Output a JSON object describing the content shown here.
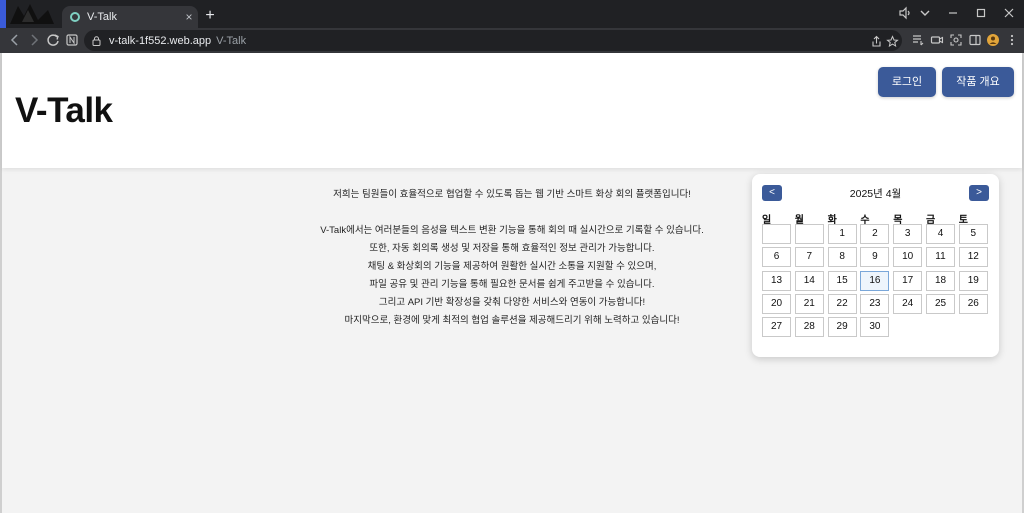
{
  "browser": {
    "tab_title": "V-Talk",
    "tab_close": "×",
    "new_tab": "+",
    "url": "v-talk-1f552.web.app",
    "url_page_title": "V-Talk",
    "window_controls": [
      "minimize-icon",
      "maximize-icon",
      "close-icon"
    ]
  },
  "header": {
    "logo": "V-Talk",
    "login_button": "로그인",
    "about_button": "작품 개요"
  },
  "intro": {
    "lead": "저희는 팀원들이 효율적으로 협업할 수 있도록 돕는 웹 기반 스마트 화상 회의 플랫폼입니다!",
    "lines": [
      "V-Talk에서는 여러분들의 음성을 텍스트 변환 기능을 통해 회의 때 실시간으로 기록할 수 있습니다.",
      "또한, 자동 회의록 생성 및 저장을 통해 효율적인 정보 관리가 가능합니다.",
      "채팅 & 화상회의 기능을 제공하여 원활한 실시간 소통을 지원할 수 있으며,",
      "파일 공유 및 관리 기능을 통해 필요한 문서를 쉽게 주고받을 수 있습니다.",
      "그리고 API 기반 확장성을 갖춰 다양한 서비스와 연동이 가능합니다!",
      "마지막으로, 환경에 맞게 최적의 협업 솔루션을 제공해드리기 위해 노력하고 있습니다!"
    ]
  },
  "calendar": {
    "title": "2025년 4월",
    "prev": "<",
    "next": ">",
    "weekdays": [
      "일",
      "월",
      "화",
      "수",
      "목",
      "금",
      "토"
    ],
    "first_weekday_index": 2,
    "days_in_month": 30,
    "highlighted_day": 16,
    "colors": {
      "button": "#3b5a99",
      "highlight_border": "#7aa7d9"
    }
  }
}
